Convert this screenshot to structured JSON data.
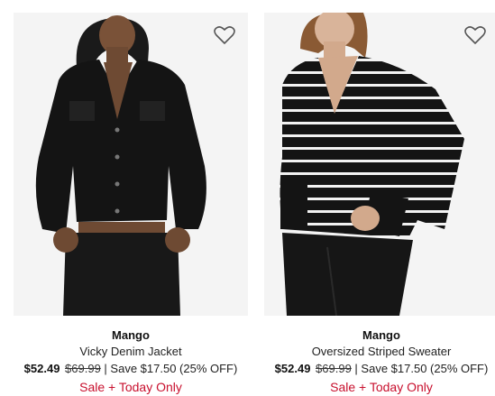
{
  "products": [
    {
      "brand": "Mango",
      "name": "Vicky Denim Jacket",
      "price_now": "$52.49",
      "price_was": "$69.99",
      "separator": " | ",
      "savings": "Save $17.50 (25% OFF)",
      "promo": "Sale + Today Only",
      "favorite_icon": "heart-outline-icon",
      "image": "model wearing black denim jacket and black jeans"
    },
    {
      "brand": "Mango",
      "name": "Oversized Striped Sweater",
      "price_now": "$52.49",
      "price_was": "$69.99",
      "separator": " | ",
      "savings": "Save $17.50 (25% OFF)",
      "promo": "Sale + Today Only",
      "favorite_icon": "heart-outline-icon",
      "image": "model wearing black and white striped v-neck sweater"
    }
  ],
  "colors": {
    "promo": "#c8102e",
    "background": "#ffffff"
  }
}
